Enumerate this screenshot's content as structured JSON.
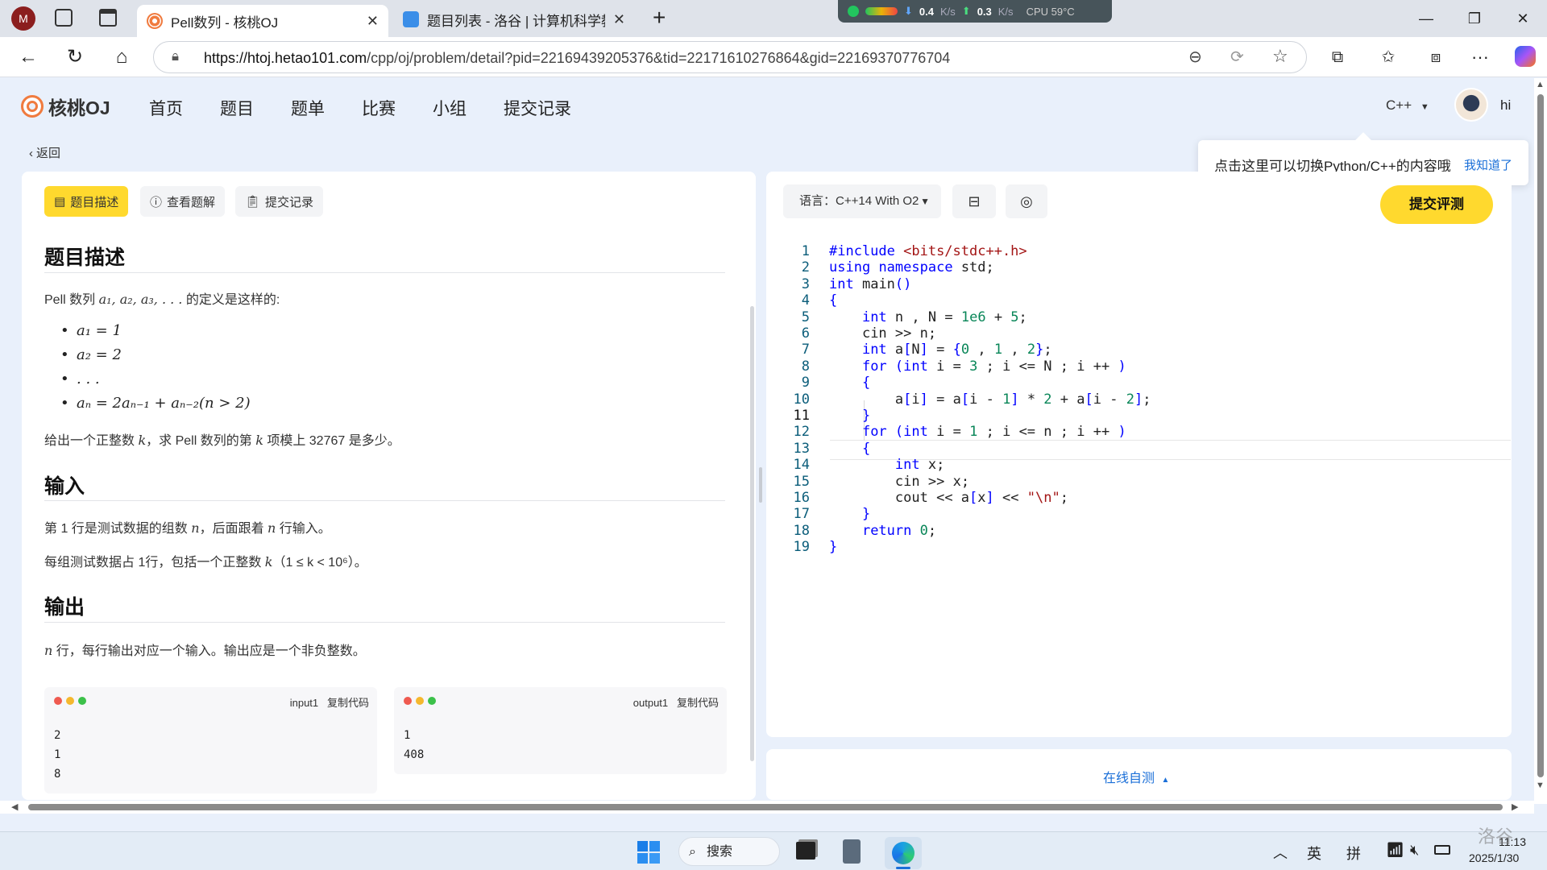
{
  "browser": {
    "tabs": [
      {
        "title": "Pell数列 - 核桃OJ",
        "active": true
      },
      {
        "title": "题目列表 - 洛谷 | 计算机科学教育",
        "active": false
      }
    ],
    "sysmon": {
      "down": "0.4",
      "down_unit": "K/s",
      "up": "0.3",
      "up_unit": "K/s",
      "cpu": "CPU 59°C"
    },
    "url_host": "https://htoj.hetao101.com",
    "url_path": "/cpp/oj/problem/detail?pid=22169439205376&tid=22171610276864&gid=22169370776704"
  },
  "site": {
    "logo": "核桃OJ",
    "nav": [
      "首页",
      "题目",
      "题单",
      "比赛",
      "小组",
      "提交记录"
    ],
    "lang_switch": "C++",
    "user": "hi",
    "tooltip": "点击这里可以切换Python/C++的内容哦",
    "tooltip_ok": "我知道了",
    "back": "返回"
  },
  "problem": {
    "tabs": [
      "题目描述",
      "查看题解",
      "提交记录"
    ],
    "desc_title": "题目描述",
    "desc_prefix": "Pell 数列 ",
    "desc_seq": "a₁, a₂, a₃, . . .",
    "desc_suffix": " 的定义是这样的:",
    "bullets": [
      "a₁ = 1",
      "a₂ = 2",
      ". . .",
      "aₙ = 2aₙ₋₁ + aₙ₋₂(n > 2)"
    ],
    "task_a": "给出一个正整数 ",
    "task_k": "k",
    "task_b": "，求 Pell 数列的第 ",
    "task_k2": "k",
    "task_c": " 项模上 32767 是多少。",
    "input_title": "输入",
    "input_line1_a": "第 1 行是测试数据的组数 ",
    "input_line1_n": "n",
    "input_line1_b": "，后面跟着 ",
    "input_line1_n2": "n",
    "input_line1_c": " 行输入。",
    "input_line2_a": "每组测试数据占 1行，包括一个正整数 ",
    "input_line2_k": "k",
    "input_line2_b": "（1 ≤ k < 10⁶）。",
    "output_title": "输出",
    "output_line_n": "n",
    "output_line": " 行，每行输出对应一个输入。输出应是一个非负整数。",
    "samples": [
      {
        "label": "input1",
        "copy": "复制代码",
        "content": "2\n1\n8"
      },
      {
        "label": "output1",
        "copy": "复制代码",
        "content": "1\n408"
      }
    ]
  },
  "editor": {
    "language": "语言：C++14 With O2",
    "submit": "提交评测",
    "online_test": "在线自测",
    "lines": [
      "#include <bits/stdc++.h>",
      "using namespace std;",
      "int main()",
      "{",
      "    int n , N = 1e6 + 5;",
      "    cin >> n;",
      "    int a[N] = {0 , 1 , 2};",
      "    for (int i = 3 ; i <= N ; i ++ )",
      "    {",
      "        a[i] = a[i - 1] * 2 + a[i - 2];",
      "    }",
      "    for (int i = 1 ; i <= n ; i ++ )",
      "    {",
      "        int x;",
      "        cin >> x;",
      "        cout << a[x] << \"\\n\";",
      "    }",
      "    return 0;",
      "}"
    ],
    "active_line": 11
  },
  "taskbar": {
    "search": "搜索",
    "ime1": "英",
    "ime2": "拼",
    "time": "11:13",
    "date": "2025/1/30",
    "watermark": "洛谷"
  },
  "colors": {
    "accent": "#ffd92e",
    "link": "#1a6fd8",
    "page_bg": "#e9f0fb"
  }
}
